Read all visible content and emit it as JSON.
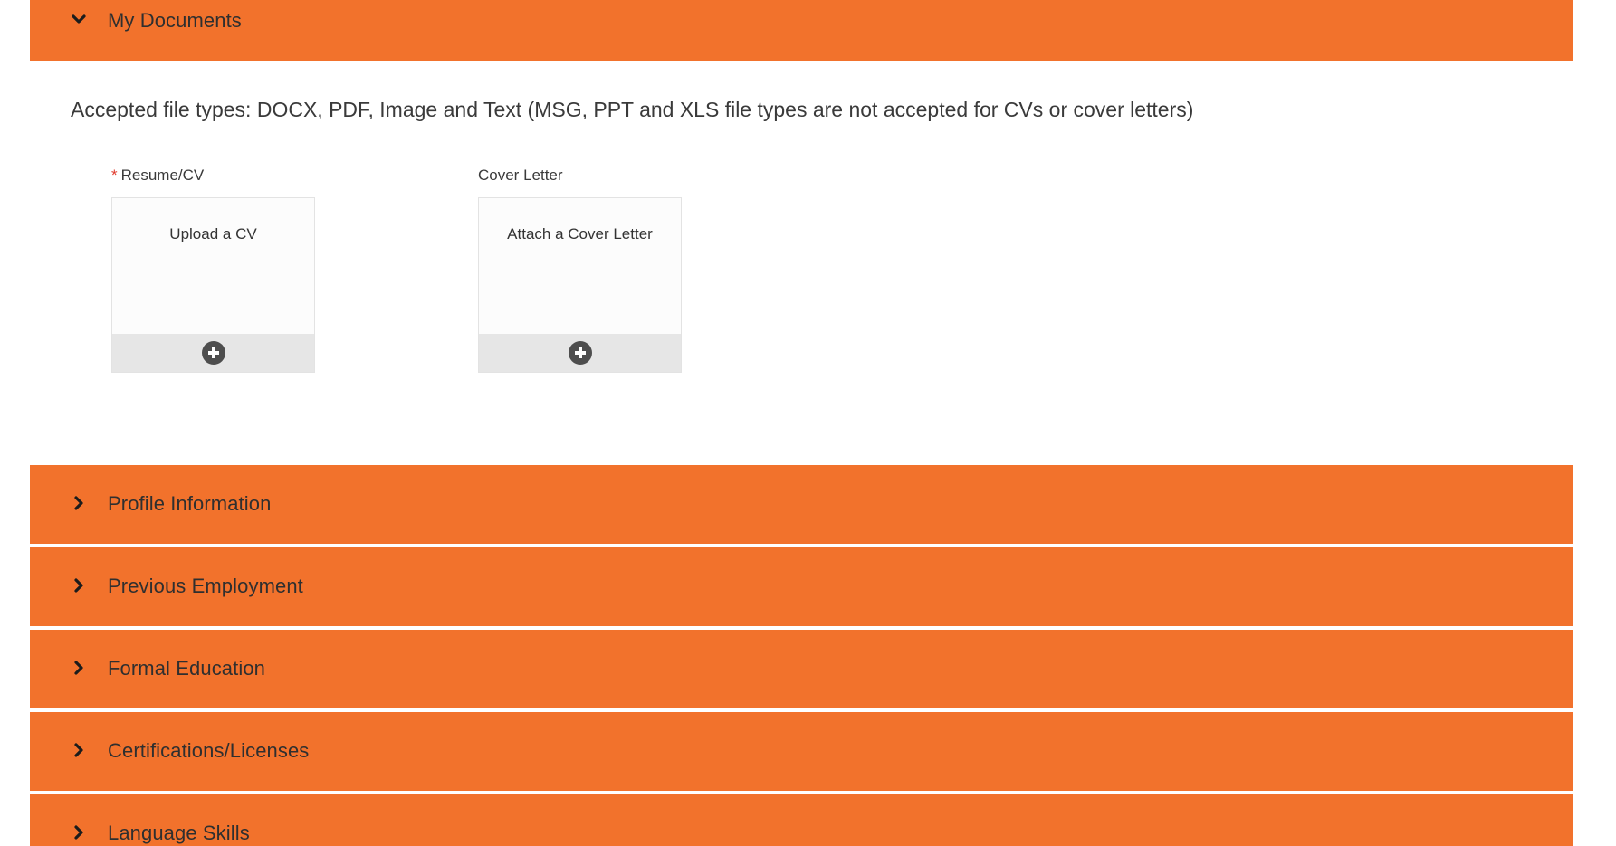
{
  "sections": {
    "my_documents": {
      "label": "My Documents",
      "expanded": true
    },
    "profile_information": {
      "label": "Profile Information",
      "expanded": false
    },
    "previous_employment": {
      "label": "Previous Employment",
      "expanded": false
    },
    "formal_education": {
      "label": "Formal Education",
      "expanded": false
    },
    "certifications": {
      "label": "Certifications/Licenses",
      "expanded": false
    },
    "language_skills": {
      "label": "Language Skills",
      "expanded": false
    }
  },
  "documents": {
    "accepted_types_text": "Accepted file types: DOCX, PDF, Image and Text (MSG, PPT and XLS file types are not accepted for CVs or cover letters)",
    "resume": {
      "required_marker": "*",
      "label": "Resume/CV",
      "card_title": "Upload a CV"
    },
    "cover_letter": {
      "label": "Cover Letter",
      "card_title": "Attach a Cover Letter"
    }
  },
  "colors": {
    "accent": "#f2722c",
    "required": "#e0392b",
    "card_footer": "#e6e6e6",
    "plus_icon": "#4e4e4e"
  },
  "icons": {
    "expanded": "chevron-down-icon",
    "collapsed": "chevron-right-icon",
    "add": "plus-circle-icon"
  }
}
